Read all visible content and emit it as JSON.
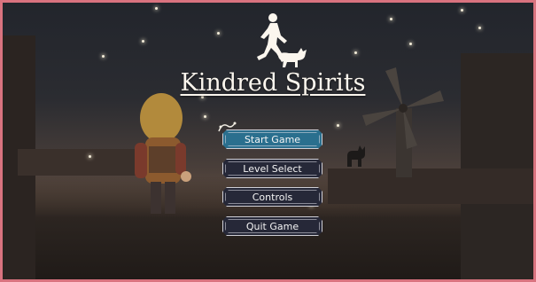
{
  "game": {
    "title": "Kindred Spirits"
  },
  "menu": {
    "items": [
      {
        "label": "Start Game",
        "selected": true
      },
      {
        "label": "Level Select",
        "selected": false
      },
      {
        "label": "Controls",
        "selected": false
      },
      {
        "label": "Quit Game",
        "selected": false
      }
    ]
  },
  "colors": {
    "frame_border": "#d9737f",
    "button_bg": "#262838",
    "button_selected_bg": "#2a6f8e",
    "title_text": "#fbf6ee"
  },
  "icons": {
    "logo": "running-child-and-dog-icon",
    "flourish": "flourish-ornament-icon"
  }
}
